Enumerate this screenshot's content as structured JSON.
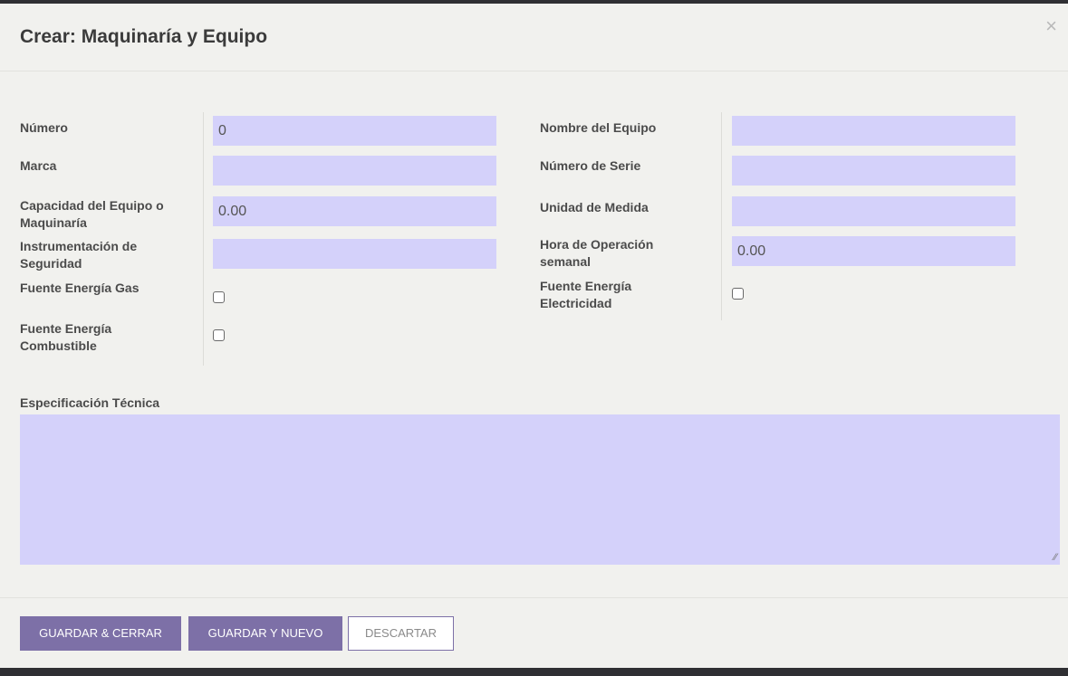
{
  "modal": {
    "title": "Crear: Maquinaría y Equipo",
    "close_glyph": "×"
  },
  "form": {
    "left": {
      "numero": {
        "label": "Número",
        "value": "0"
      },
      "marca": {
        "label": "Marca",
        "value": ""
      },
      "capacidad": {
        "label": "Capacidad del Equipo o Maquinaría",
        "value": "0.00"
      },
      "instrumentacion": {
        "label": "Instrumentación de Seguridad",
        "value": ""
      },
      "fuente_gas": {
        "label": "Fuente Energía Gas",
        "checked": false
      },
      "fuente_combustible": {
        "label": "Fuente Energía Combustible",
        "checked": false
      }
    },
    "right": {
      "nombre_equipo": {
        "label": "Nombre del Equipo",
        "value": ""
      },
      "numero_serie": {
        "label": "Número de Serie",
        "value": ""
      },
      "unidad_medida": {
        "label": "Unidad de Medida",
        "value": ""
      },
      "hora_operacion": {
        "label": "Hora de Operación semanal",
        "value": "0.00"
      },
      "fuente_electricidad": {
        "label": "Fuente Energía Electricidad",
        "checked": false
      }
    },
    "especificacion": {
      "label": "Especificación Técnica",
      "value": ""
    }
  },
  "footer": {
    "save_close_label": "GUARDAR & CERRAR",
    "save_new_label": "GUARDAR Y NUEVO",
    "discard_label": "DESCARTAR"
  },
  "colors": {
    "input_bg": "#d4d1fa",
    "primary_button": "#7d70a7",
    "modal_bg": "#f1f1ee"
  }
}
